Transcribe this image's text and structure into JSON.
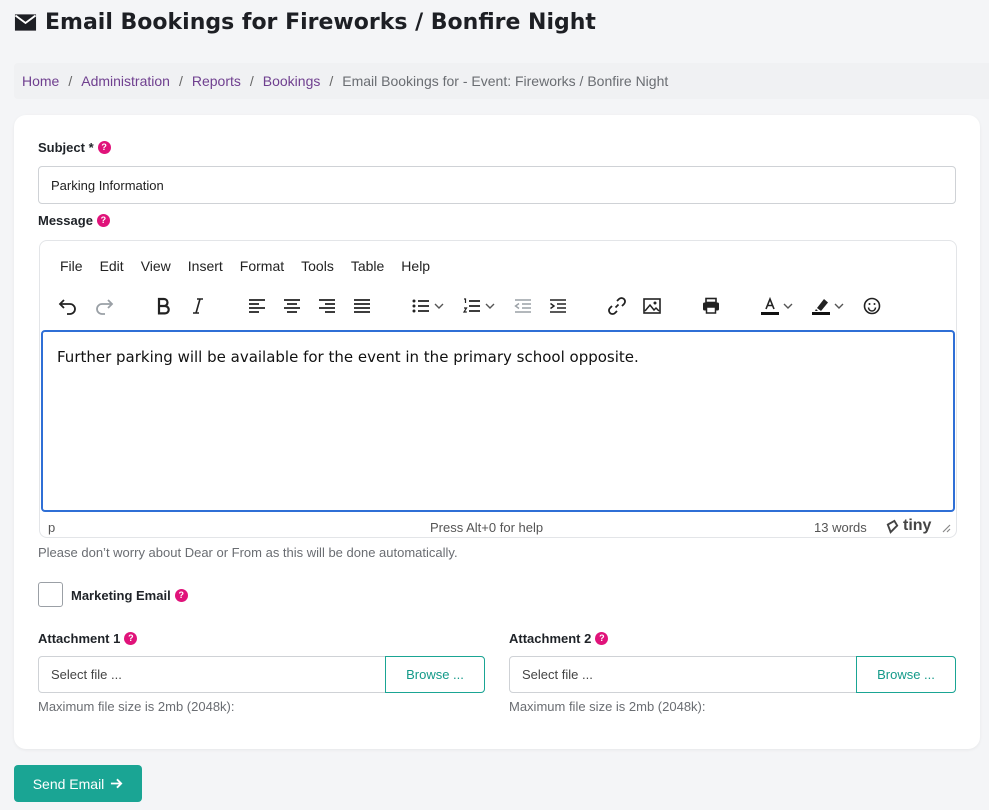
{
  "header": {
    "title": "Email Bookings for Fireworks / Bonfire Night",
    "icon": "envelope-icon"
  },
  "breadcrumb": {
    "items": [
      "Home",
      "Administration",
      "Reports",
      "Bookings"
    ],
    "separator": "/",
    "current": "Email Bookings for - Event: Fireworks / Bonfire Night"
  },
  "form": {
    "subject_label": "Subject *",
    "subject_value": "Parking Information",
    "message_label": "Message",
    "help_glyph": "?",
    "hint_text": "Please don’t worry about Dear or From as this will be done automatically.",
    "marketing_label": "Marketing Email",
    "attachment1_label": "Attachment 1",
    "attachment2_label": "Attachment 2",
    "file_placeholder": "Select file ...",
    "browse_label": "Browse ...",
    "file_size_note": "Maximum file size is 2mb (2048k):",
    "send_label": "Send Email"
  },
  "editor": {
    "menu": [
      "File",
      "Edit",
      "View",
      "Insert",
      "Format",
      "Tools",
      "Table",
      "Help"
    ],
    "content": "Further parking will be available for the event in the primary school opposite.",
    "status_path": "p",
    "status_help": "Press Alt+0 for help",
    "word_count": "13 words",
    "brand": "tiny"
  },
  "colors": {
    "accent_teal": "#1aa594",
    "help_magenta": "#e0137a",
    "link_purple": "#6f3f8f",
    "editor_focus": "#2f6fd6"
  }
}
